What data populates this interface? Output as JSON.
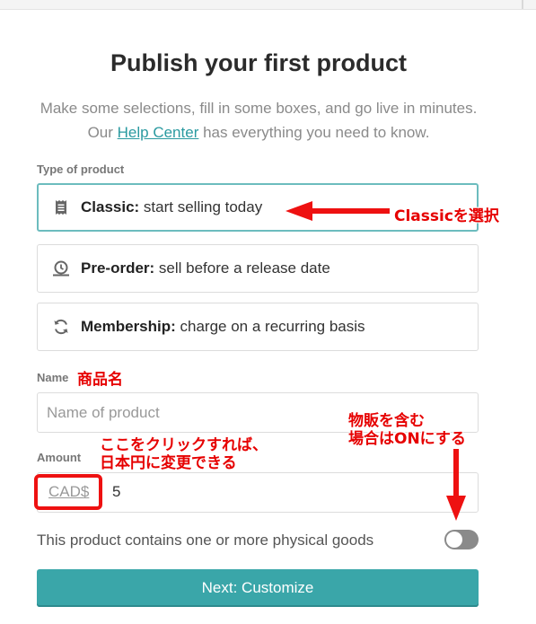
{
  "header": {
    "title": "Publish your first product",
    "subtitle_prefix": "Make some selections, fill in some boxes, and go live in minutes. Our ",
    "help_link": "Help Center",
    "subtitle_suffix": " has everything you need to know."
  },
  "type_section": {
    "label": "Type of product",
    "options": [
      {
        "bold": "Classic:",
        "text": " start selling today",
        "icon": "receipt-icon",
        "selected": true
      },
      {
        "bold": "Pre-order:",
        "text": " sell before a release date",
        "icon": "clock-icon",
        "selected": false
      },
      {
        "bold": "Membership:",
        "text": " charge on a recurring basis",
        "icon": "refresh-icon",
        "selected": false
      }
    ]
  },
  "name_section": {
    "label": "Name",
    "placeholder": "Name of product",
    "value": ""
  },
  "amount_section": {
    "label": "Amount",
    "currency": "CAD$",
    "value": "5"
  },
  "physical": {
    "text": "This product contains one or more physical goods",
    "toggle_on": false
  },
  "next_button": {
    "label": "Next: Customize"
  },
  "annotations": {
    "classic_note": "Classicを選択",
    "name_note": "商品名",
    "currency_note_line1": "ここをクリックすれば、",
    "currency_note_line2": "日本円に変更できる",
    "physical_note_line1": "物販を含む",
    "physical_note_line2": "場合はONにする",
    "color": "#e60000"
  },
  "colors": {
    "accent": "#3aa6a9",
    "selected_border": "#6cbcbe",
    "link": "#2a9aa0"
  }
}
